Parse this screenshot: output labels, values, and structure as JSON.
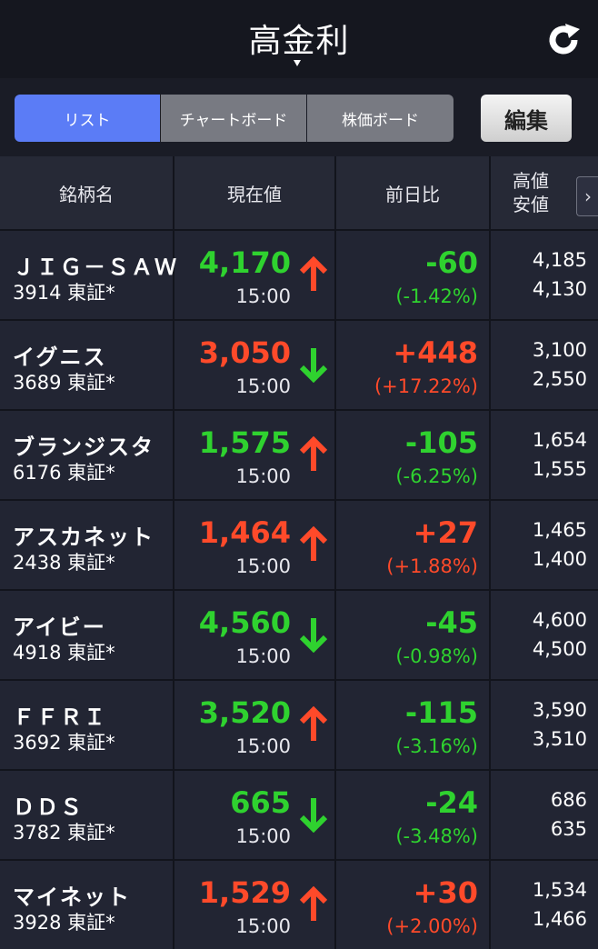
{
  "header": {
    "title": "高金利"
  },
  "tabs": [
    {
      "label": "リスト",
      "active": true
    },
    {
      "label": "チャートボード",
      "active": false
    },
    {
      "label": "株価ボード",
      "active": false
    }
  ],
  "edit_label": "編集",
  "columns": {
    "name": "銘柄名",
    "price": "現在値",
    "diff": "前日比",
    "high": "高値",
    "low": "安値",
    "next": "›"
  },
  "colors": {
    "up": "#2fd22f",
    "down": "#ff4a2a",
    "accent": "#5b7cf6"
  },
  "rows": [
    {
      "name": "ＪＩＧ－ＳＡＷ",
      "code": "3914 東証*",
      "price": "4,170",
      "price_color": "green",
      "time": "15:00",
      "arrow": "up",
      "change": "-60",
      "pct": "(-1.42%)",
      "change_color": "green",
      "high": "4,185",
      "low": "4,130"
    },
    {
      "name": "イグニス",
      "code": "3689 東証*",
      "price": "3,050",
      "price_color": "red",
      "time": "15:00",
      "arrow": "down",
      "change": "+448",
      "pct": "(+17.22%)",
      "change_color": "red",
      "high": "3,100",
      "low": "2,550"
    },
    {
      "name": "ブランジスタ",
      "code": "6176 東証*",
      "price": "1,575",
      "price_color": "green",
      "time": "15:00",
      "arrow": "up",
      "change": "-105",
      "pct": "(-6.25%)",
      "change_color": "green",
      "high": "1,654",
      "low": "1,555"
    },
    {
      "name": "アスカネット",
      "code": "2438 東証*",
      "price": "1,464",
      "price_color": "red",
      "time": "15:00",
      "arrow": "up",
      "change": "+27",
      "pct": "(+1.88%)",
      "change_color": "red",
      "high": "1,465",
      "low": "1,400"
    },
    {
      "name": "アイビー",
      "code": "4918 東証*",
      "price": "4,560",
      "price_color": "green",
      "time": "15:00",
      "arrow": "down",
      "change": "-45",
      "pct": "(-0.98%)",
      "change_color": "green",
      "high": "4,600",
      "low": "4,500"
    },
    {
      "name": "ＦＦＲＩ",
      "code": "3692 東証*",
      "price": "3,520",
      "price_color": "green",
      "time": "15:00",
      "arrow": "up",
      "change": "-115",
      "pct": "(-3.16%)",
      "change_color": "green",
      "high": "3,590",
      "low": "3,510"
    },
    {
      "name": "ＤＤＳ",
      "code": "3782 東証*",
      "price": "665",
      "price_color": "green",
      "time": "15:00",
      "arrow": "down",
      "change": "-24",
      "pct": "(-3.48%)",
      "change_color": "green",
      "high": "686",
      "low": "635"
    },
    {
      "name": "マイネット",
      "code": "3928 東証*",
      "price": "1,529",
      "price_color": "red",
      "time": "15:00",
      "arrow": "up",
      "change": "+30",
      "pct": "(+2.00%)",
      "change_color": "red",
      "high": "1,534",
      "low": "1,466"
    }
  ]
}
